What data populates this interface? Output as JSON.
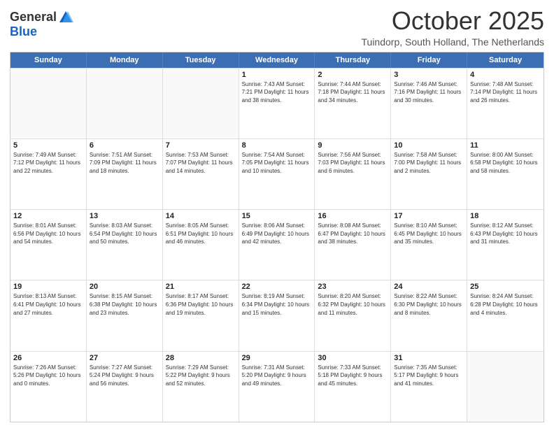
{
  "header": {
    "logo_general": "General",
    "logo_blue": "Blue",
    "month_title": "October 2025",
    "location": "Tuindorp, South Holland, The Netherlands"
  },
  "weekdays": [
    "Sunday",
    "Monday",
    "Tuesday",
    "Wednesday",
    "Thursday",
    "Friday",
    "Saturday"
  ],
  "rows": [
    [
      {
        "day": "",
        "info": ""
      },
      {
        "day": "",
        "info": ""
      },
      {
        "day": "",
        "info": ""
      },
      {
        "day": "1",
        "info": "Sunrise: 7:43 AM\nSunset: 7:21 PM\nDaylight: 11 hours\nand 38 minutes."
      },
      {
        "day": "2",
        "info": "Sunrise: 7:44 AM\nSunset: 7:18 PM\nDaylight: 11 hours\nand 34 minutes."
      },
      {
        "day": "3",
        "info": "Sunrise: 7:46 AM\nSunset: 7:16 PM\nDaylight: 11 hours\nand 30 minutes."
      },
      {
        "day": "4",
        "info": "Sunrise: 7:48 AM\nSunset: 7:14 PM\nDaylight: 11 hours\nand 26 minutes."
      }
    ],
    [
      {
        "day": "5",
        "info": "Sunrise: 7:49 AM\nSunset: 7:12 PM\nDaylight: 11 hours\nand 22 minutes."
      },
      {
        "day": "6",
        "info": "Sunrise: 7:51 AM\nSunset: 7:09 PM\nDaylight: 11 hours\nand 18 minutes."
      },
      {
        "day": "7",
        "info": "Sunrise: 7:53 AM\nSunset: 7:07 PM\nDaylight: 11 hours\nand 14 minutes."
      },
      {
        "day": "8",
        "info": "Sunrise: 7:54 AM\nSunset: 7:05 PM\nDaylight: 11 hours\nand 10 minutes."
      },
      {
        "day": "9",
        "info": "Sunrise: 7:56 AM\nSunset: 7:03 PM\nDaylight: 11 hours\nand 6 minutes."
      },
      {
        "day": "10",
        "info": "Sunrise: 7:58 AM\nSunset: 7:00 PM\nDaylight: 11 hours\nand 2 minutes."
      },
      {
        "day": "11",
        "info": "Sunrise: 8:00 AM\nSunset: 6:58 PM\nDaylight: 10 hours\nand 58 minutes."
      }
    ],
    [
      {
        "day": "12",
        "info": "Sunrise: 8:01 AM\nSunset: 6:56 PM\nDaylight: 10 hours\nand 54 minutes."
      },
      {
        "day": "13",
        "info": "Sunrise: 8:03 AM\nSunset: 6:54 PM\nDaylight: 10 hours\nand 50 minutes."
      },
      {
        "day": "14",
        "info": "Sunrise: 8:05 AM\nSunset: 6:51 PM\nDaylight: 10 hours\nand 46 minutes."
      },
      {
        "day": "15",
        "info": "Sunrise: 8:06 AM\nSunset: 6:49 PM\nDaylight: 10 hours\nand 42 minutes."
      },
      {
        "day": "16",
        "info": "Sunrise: 8:08 AM\nSunset: 6:47 PM\nDaylight: 10 hours\nand 38 minutes."
      },
      {
        "day": "17",
        "info": "Sunrise: 8:10 AM\nSunset: 6:45 PM\nDaylight: 10 hours\nand 35 minutes."
      },
      {
        "day": "18",
        "info": "Sunrise: 8:12 AM\nSunset: 6:43 PM\nDaylight: 10 hours\nand 31 minutes."
      }
    ],
    [
      {
        "day": "19",
        "info": "Sunrise: 8:13 AM\nSunset: 6:41 PM\nDaylight: 10 hours\nand 27 minutes."
      },
      {
        "day": "20",
        "info": "Sunrise: 8:15 AM\nSunset: 6:38 PM\nDaylight: 10 hours\nand 23 minutes."
      },
      {
        "day": "21",
        "info": "Sunrise: 8:17 AM\nSunset: 6:36 PM\nDaylight: 10 hours\nand 19 minutes."
      },
      {
        "day": "22",
        "info": "Sunrise: 8:19 AM\nSunset: 6:34 PM\nDaylight: 10 hours\nand 15 minutes."
      },
      {
        "day": "23",
        "info": "Sunrise: 8:20 AM\nSunset: 6:32 PM\nDaylight: 10 hours\nand 11 minutes."
      },
      {
        "day": "24",
        "info": "Sunrise: 8:22 AM\nSunset: 6:30 PM\nDaylight: 10 hours\nand 8 minutes."
      },
      {
        "day": "25",
        "info": "Sunrise: 8:24 AM\nSunset: 6:28 PM\nDaylight: 10 hours\nand 4 minutes."
      }
    ],
    [
      {
        "day": "26",
        "info": "Sunrise: 7:26 AM\nSunset: 5:26 PM\nDaylight: 10 hours\nand 0 minutes."
      },
      {
        "day": "27",
        "info": "Sunrise: 7:27 AM\nSunset: 5:24 PM\nDaylight: 9 hours\nand 56 minutes."
      },
      {
        "day": "28",
        "info": "Sunrise: 7:29 AM\nSunset: 5:22 PM\nDaylight: 9 hours\nand 52 minutes."
      },
      {
        "day": "29",
        "info": "Sunrise: 7:31 AM\nSunset: 5:20 PM\nDaylight: 9 hours\nand 49 minutes."
      },
      {
        "day": "30",
        "info": "Sunrise: 7:33 AM\nSunset: 5:18 PM\nDaylight: 9 hours\nand 45 minutes."
      },
      {
        "day": "31",
        "info": "Sunrise: 7:35 AM\nSunset: 5:17 PM\nDaylight: 9 hours\nand 41 minutes."
      },
      {
        "day": "",
        "info": ""
      }
    ]
  ]
}
